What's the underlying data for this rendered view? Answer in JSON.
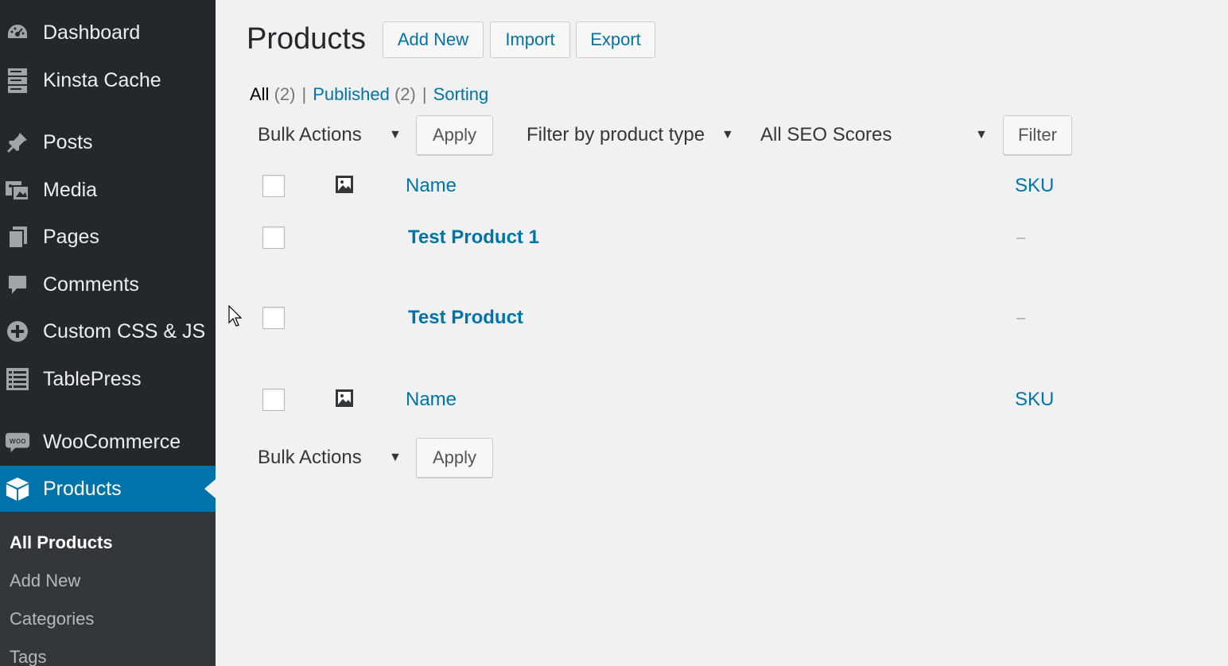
{
  "sidebar": {
    "items": [
      {
        "label": "Dashboard",
        "icon": "dashboard-icon"
      },
      {
        "label": "Kinsta Cache",
        "icon": "server-icon"
      },
      {
        "label": "Posts",
        "icon": "pin-icon"
      },
      {
        "label": "Media",
        "icon": "media-icon"
      },
      {
        "label": "Pages",
        "icon": "pages-icon"
      },
      {
        "label": "Comments",
        "icon": "comment-icon"
      },
      {
        "label": "Custom CSS & JS",
        "icon": "plus-circle-icon"
      },
      {
        "label": "TablePress",
        "icon": "list-icon"
      },
      {
        "label": "WooCommerce",
        "icon": "woo-icon",
        "icon_text": "woo"
      },
      {
        "label": "Products",
        "icon": "box-icon"
      }
    ],
    "submenu": [
      "All Products",
      "Add New",
      "Categories",
      "Tags"
    ]
  },
  "header": {
    "title": "Products",
    "add_new": "Add New",
    "import": "Import",
    "export": "Export"
  },
  "views": {
    "all": "All",
    "all_count": "(2)",
    "published": "Published",
    "published_count": "(2)",
    "sorting": "Sorting",
    "separator": "|"
  },
  "filters": {
    "bulk_actions": "Bulk Actions",
    "apply": "Apply",
    "product_type": "Filter by product type",
    "seo_scores": "All SEO Scores",
    "filter": "Filter",
    "arrow": "▼"
  },
  "table": {
    "columns": {
      "name": "Name",
      "sku": "SKU"
    },
    "rows": [
      {
        "name": "Test Product 1",
        "sku": "–"
      },
      {
        "name": "Test Product",
        "sku": "–"
      }
    ]
  },
  "colors": {
    "sidebar": "#23282d",
    "active": "#0073aa",
    "link": "#0073aa"
  }
}
